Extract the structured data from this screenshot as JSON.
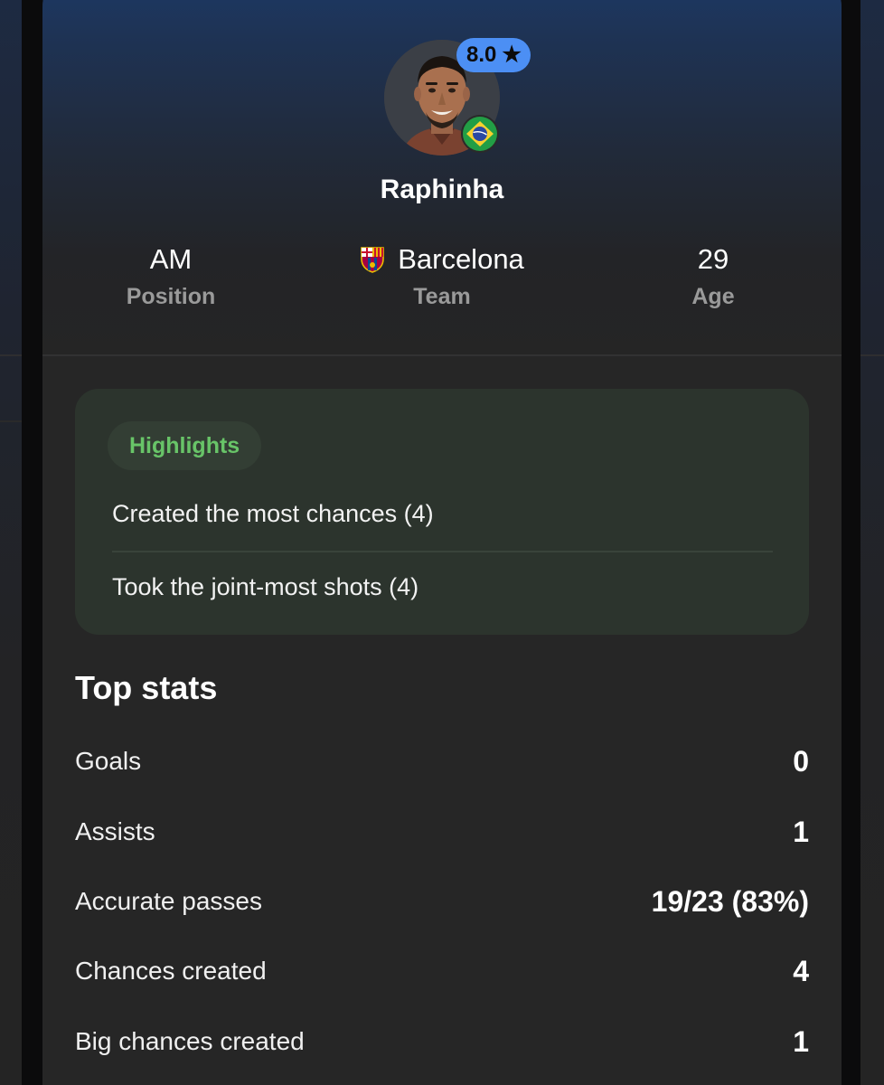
{
  "player": {
    "name": "Raphinha",
    "rating": "8.0",
    "rating_icon": "star-icon",
    "nationality_flag": "brazil-flag-icon",
    "position": "AM",
    "position_label": "Position",
    "team": "Barcelona",
    "team_label": "Team",
    "team_crest": "barcelona-crest-icon",
    "age": "29",
    "age_label": "Age"
  },
  "highlights": {
    "title": "Highlights",
    "items": [
      "Created the most chances (4)",
      "Took the joint-most shots (4)"
    ]
  },
  "top_stats": {
    "title": "Top stats",
    "rows": [
      {
        "label": "Goals",
        "value": "0"
      },
      {
        "label": "Assists",
        "value": "1"
      },
      {
        "label": "Accurate passes",
        "value": "19/23 (83%)"
      },
      {
        "label": "Chances created",
        "value": "4"
      },
      {
        "label": "Big chances created",
        "value": "1"
      }
    ]
  },
  "colors": {
    "rating_badge": "#4c8ff4",
    "highlight_accent": "#68c468",
    "card_background": "#262626",
    "highlights_background": "#2c342d"
  }
}
